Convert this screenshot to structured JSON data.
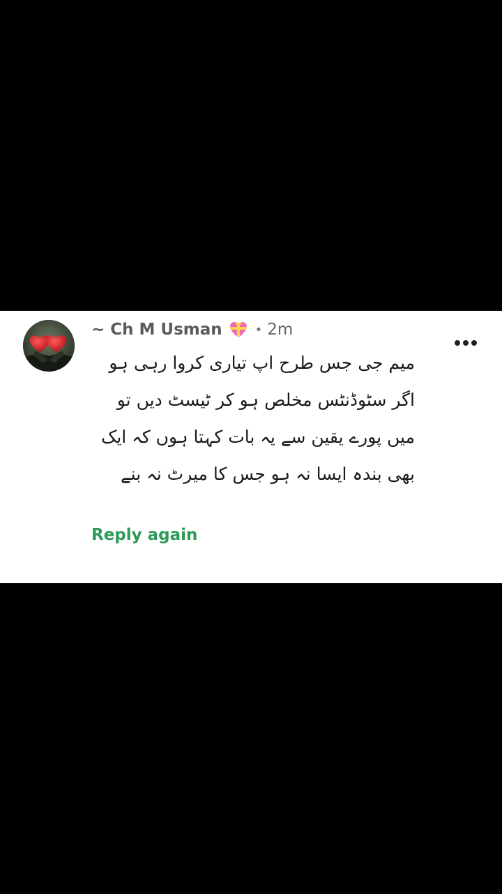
{
  "comment": {
    "author": "~ Ch M Usman",
    "badge_icon": "gift-heart-icon",
    "separator": "•",
    "timestamp": "2m",
    "body": "میم جی جس طرح اپ تیاری کروا رہی ہو اگر سٹوڈنٹس مخلص ہو کر ٹیسٹ دیں تو میں پورے یقین سے یہ بات کہتا ہوں کہ ایک بھی بندہ ایسا نہ ہو جس کا میرٹ نہ بنے",
    "reply_label": "Reply again",
    "more_icon": "more-options-icon"
  },
  "colors": {
    "reply_accent": "#2e9a5a",
    "background": "#000000",
    "card": "#ffffff"
  }
}
